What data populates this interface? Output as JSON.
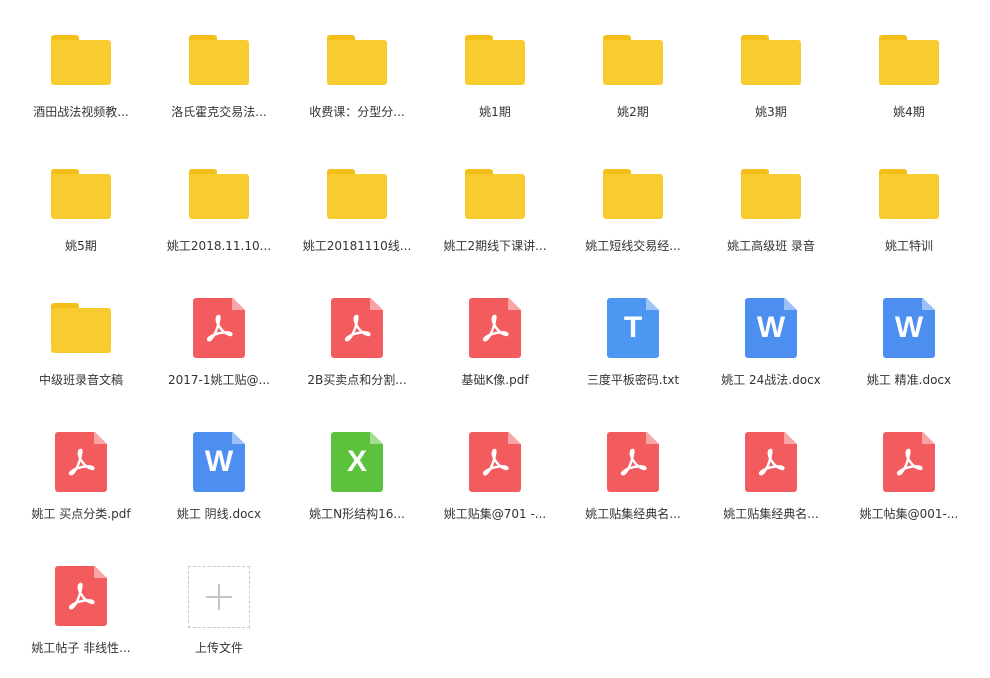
{
  "files": [
    {
      "name": "酒田战法视频教...",
      "type": "folder"
    },
    {
      "name": "洛氏霍克交易法...",
      "type": "folder"
    },
    {
      "name": "收费课：分型分...",
      "type": "folder"
    },
    {
      "name": "姚1期",
      "type": "folder"
    },
    {
      "name": "姚2期",
      "type": "folder"
    },
    {
      "name": "姚3期",
      "type": "folder"
    },
    {
      "name": "姚4期",
      "type": "folder"
    },
    {
      "name": "姚5期",
      "type": "folder"
    },
    {
      "name": "姚工2018.11.10...",
      "type": "folder"
    },
    {
      "name": "姚工20181110线...",
      "type": "folder"
    },
    {
      "name": "姚工2期线下课讲...",
      "type": "folder"
    },
    {
      "name": "姚工短线交易经...",
      "type": "folder"
    },
    {
      "name": "姚工高级班 录音",
      "type": "folder"
    },
    {
      "name": "姚工特训",
      "type": "folder"
    },
    {
      "name": "中级班录音文稿",
      "type": "folder"
    },
    {
      "name": "2017-1姚工贴@...",
      "type": "pdf"
    },
    {
      "name": "2B买卖点和分割...",
      "type": "pdf"
    },
    {
      "name": "基础K像.pdf",
      "type": "pdf"
    },
    {
      "name": "三度平板密码.txt",
      "type": "txt",
      "glyph": "T"
    },
    {
      "name": "姚工 24战法.docx",
      "type": "docx",
      "glyph": "W"
    },
    {
      "name": "姚工 精准.docx",
      "type": "docx",
      "glyph": "W"
    },
    {
      "name": "姚工 买点分类.pdf",
      "type": "pdf"
    },
    {
      "name": "姚工 阴线.docx",
      "type": "docx",
      "glyph": "W"
    },
    {
      "name": "姚工N形结构16...",
      "type": "xlsx",
      "glyph": "X"
    },
    {
      "name": "姚工贴集@701 -...",
      "type": "pdf"
    },
    {
      "name": "姚工贴集经典名...",
      "type": "pdf"
    },
    {
      "name": "姚工贴集经典名...",
      "type": "pdf"
    },
    {
      "name": "姚工帖集@001-...",
      "type": "pdf"
    },
    {
      "name": "姚工帖子 非线性...",
      "type": "pdf"
    }
  ],
  "upload": {
    "label": "上传文件"
  },
  "icons": {
    "folder": "folder-icon",
    "pdf": "pdf-file-icon",
    "txt": "txt-file-icon",
    "docx": "word-file-icon",
    "xlsx": "excel-file-icon",
    "upload": "plus-icon"
  },
  "colors": {
    "folder": "#f8cb2e",
    "pdf": "#f35c5f",
    "txt": "#4d97f3",
    "docx": "#4d8ef1",
    "xlsx": "#5cc13c"
  }
}
